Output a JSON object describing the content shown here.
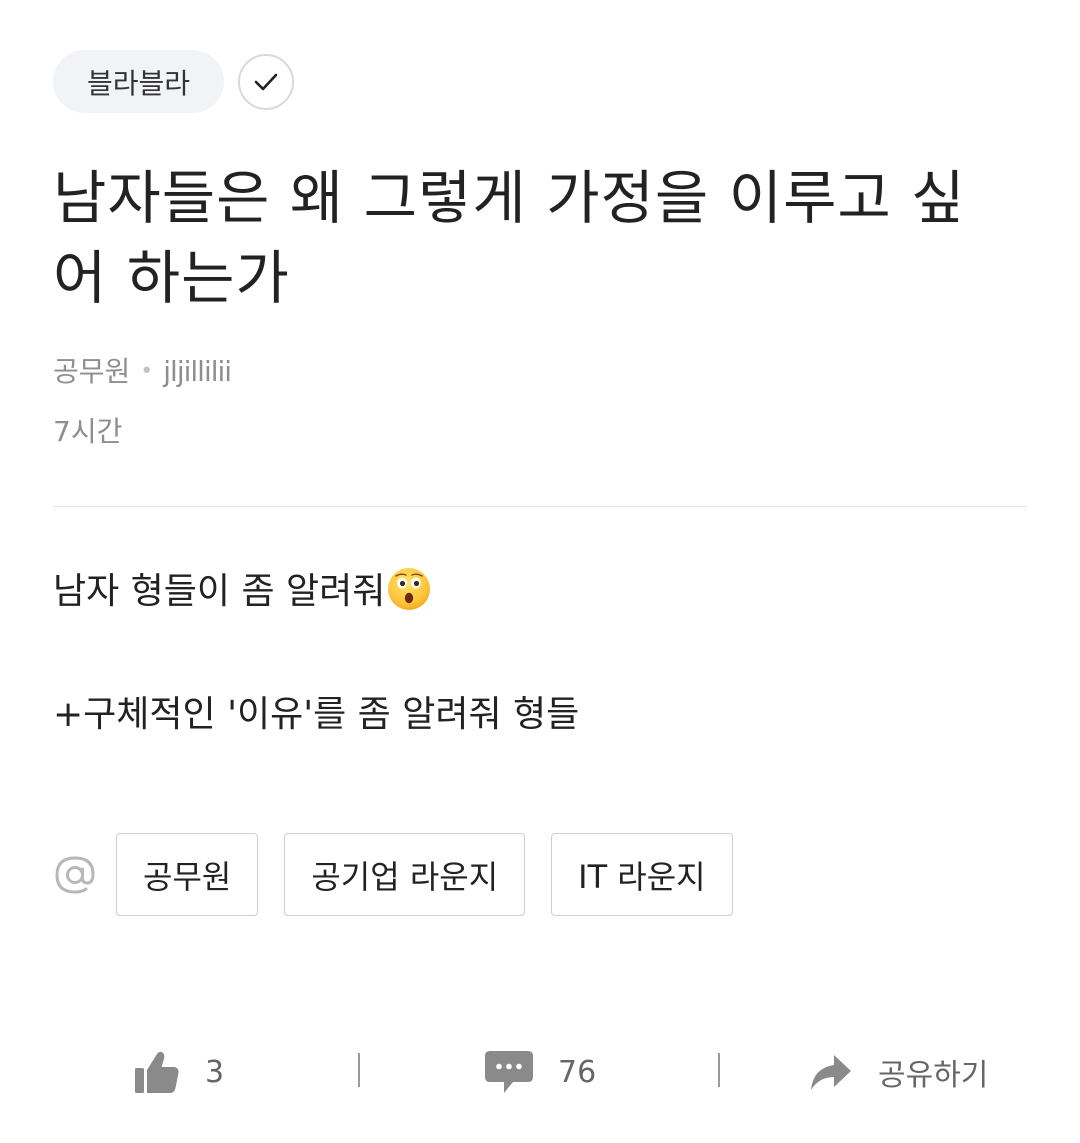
{
  "header": {
    "category": "블라블라",
    "follow_icon": "check-icon"
  },
  "post": {
    "title": "남자들은 왜 그렇게 가정을 이루고 싶어 하는가",
    "company": "공무원",
    "author": "jljillilii",
    "time": "7시간",
    "body_line1": "남자 형들이 좀 알려줘",
    "body_line1_emoji": "hushed-face-emoji",
    "body_line2": "+구체적인 '이유'를 좀 알려줘 형들"
  },
  "tags": {
    "icon": "at-sign-icon",
    "items": [
      {
        "label": "공무원"
      },
      {
        "label": "공기업 라운지"
      },
      {
        "label": "IT 라운지"
      }
    ]
  },
  "actions": {
    "like_count": "3",
    "comment_count": "76",
    "share_label": "공유하기",
    "like_icon": "thumbs-up-icon",
    "comment_icon": "speech-bubble-icon",
    "share_icon": "share-arrow-icon"
  },
  "colors": {
    "text": "#222222",
    "muted": "#8e8e8e",
    "chip_bg": "#f1f3f6",
    "icon_gray": "#8a8a8a"
  }
}
